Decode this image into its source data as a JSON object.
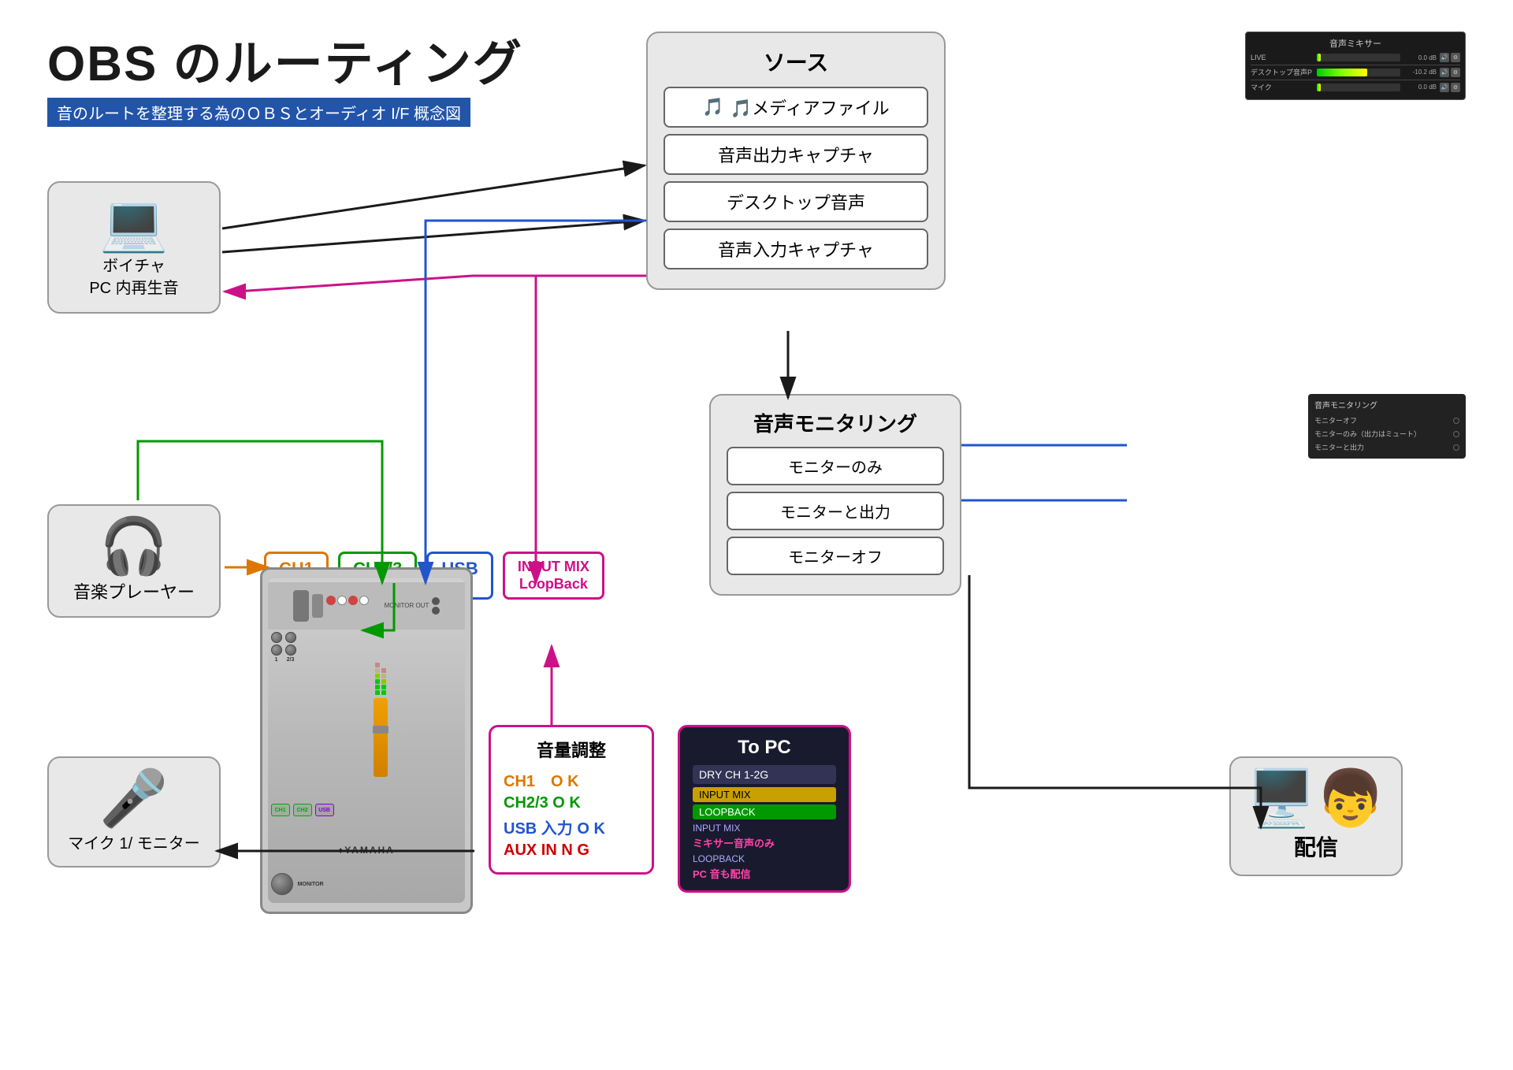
{
  "title": {
    "main": "OBS のルーティング",
    "sub": "音のルートを整理する為のＯＢＳとオーディオ I/F 概念図"
  },
  "source_box": {
    "title": "ソース",
    "items": [
      {
        "label": "🎵メディアファイル",
        "id": "media-file"
      },
      {
        "label": "音声出力キャプチャ",
        "id": "audio-output-capture"
      },
      {
        "label": "デスクトップ音声",
        "id": "desktop-audio"
      },
      {
        "label": "音声入力キャプチャ",
        "id": "audio-input-capture"
      }
    ]
  },
  "obs_mixer": {
    "title": "音声ミキサー",
    "rows": [
      {
        "label": "LIVE",
        "value": "0.0 dB",
        "bar_pct": 5
      },
      {
        "label": "デスクトップ音声P",
        "value": "-10.2 dB",
        "bar_pct": 60
      },
      {
        "label": "マイク",
        "value": "0.0 dB",
        "bar_pct": 5
      }
    ]
  },
  "voice_pc": {
    "icon": "💻",
    "label": "ボイチャ\nPC 内再生音"
  },
  "music_player": {
    "icon": "🎵",
    "label": "音楽プレーヤー"
  },
  "mic": {
    "icon": "🎤",
    "label": "マイク 1/ モニター"
  },
  "monitoring_box": {
    "title": "音声モニタリング",
    "items": [
      {
        "label": "モニターのみ"
      },
      {
        "label": "モニターと出力"
      },
      {
        "label": "モニターオフ"
      }
    ]
  },
  "obs_monitoring": {
    "title": "音声モニタリング",
    "rows": [
      {
        "label": "モニターオフ"
      },
      {
        "label": "モニターのみ（出力はミュート）"
      },
      {
        "label": "モニターと出力"
      }
    ]
  },
  "ch_inputs": {
    "ch1": "CH1",
    "ch2": "CH2/3",
    "usb": "USB",
    "inputmix": "INPUT MIX\nLoopBack"
  },
  "volume_box": {
    "title": "音量調整",
    "rows": [
      {
        "label": "CH1　O K",
        "color": "orange"
      },
      {
        "label": "CH2/3  O K",
        "color": "green"
      },
      {
        "label": "USB 入力 O K",
        "color": "blue"
      },
      {
        "label": "AUX IN  N G",
        "color": "red"
      }
    ]
  },
  "topc_box": {
    "title": "To  PC",
    "dry_label": "DRY CH 1-2G",
    "input_mix_label": "INPUT MIX",
    "loopback_label": "LOOPBACK",
    "input_mix_note_title": "INPUT MIX",
    "input_mix_note": "ミキサー音声のみ",
    "loopback_note_title": "LOOPBACK",
    "loopback_note": "PC 音も配信"
  },
  "delivery": {
    "icon": "🖥️",
    "label": "配信"
  },
  "mixer_device": {
    "brand": "♦YAMAHA"
  },
  "arrows": {
    "colors": {
      "dark": "#1a1a1a",
      "blue": "#2255cc",
      "pink": "#cc1188",
      "orange": "#dd7700",
      "green": "#009900"
    }
  }
}
